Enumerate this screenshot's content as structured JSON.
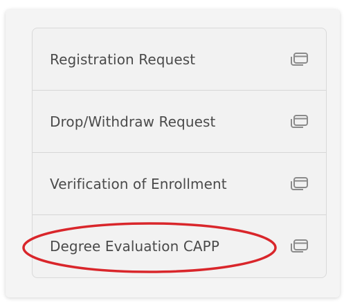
{
  "menu": {
    "items": [
      {
        "label": "Registration Request",
        "icon": "open-in-new-window-icon"
      },
      {
        "label": "Drop/Withdraw Request",
        "icon": "open-in-new-window-icon"
      },
      {
        "label": "Verification of Enrollment",
        "icon": "open-in-new-window-icon"
      },
      {
        "label": "Degree Evaluation CAPP",
        "icon": "open-in-new-window-icon"
      }
    ]
  },
  "annotation": {
    "shape": "ellipse",
    "color": "#d9262b",
    "target": "Degree Evaluation CAPP"
  },
  "colors": {
    "card_background": "#f2f2f2",
    "text": "#4a4a4a",
    "icon": "#8a8a8a",
    "highlight": "#d9262b"
  }
}
